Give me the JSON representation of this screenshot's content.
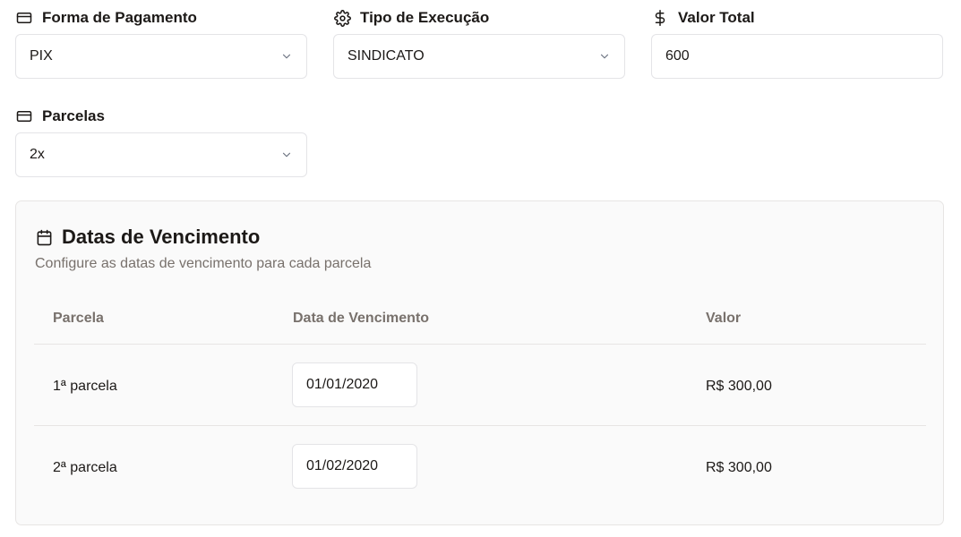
{
  "fields": {
    "forma": {
      "label": "Forma de Pagamento",
      "value": "PIX",
      "icon": "credit-card-icon"
    },
    "tipo": {
      "label": "Tipo de Execução",
      "value": "SINDICATO",
      "icon": "gear-icon"
    },
    "valor": {
      "label": "Valor Total",
      "value": "600",
      "icon": "dollar-icon"
    },
    "parcelas": {
      "label": "Parcelas",
      "value": "2x",
      "icon": "credit-card-icon"
    }
  },
  "card": {
    "title": "Datas de Vencimento",
    "subtitle": "Configure as datas de vencimento para cada parcela",
    "icon": "calendar-icon",
    "columns": [
      "Parcela",
      "Data de Vencimento",
      "Valor"
    ],
    "rows": [
      {
        "parcela": "1ª parcela",
        "data": "01/01/2020",
        "valor": "R$ 300,00"
      },
      {
        "parcela": "2ª parcela",
        "data": "01/02/2020",
        "valor": "R$ 300,00"
      }
    ]
  }
}
